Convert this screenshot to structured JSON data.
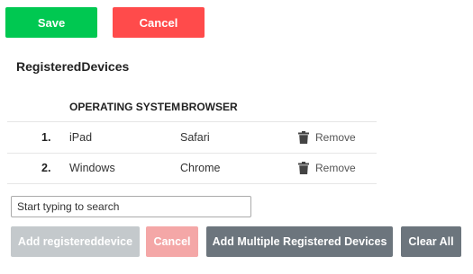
{
  "toolbar": {
    "save_label": "Save",
    "cancel_label": "Cancel"
  },
  "section": {
    "title": "RegisteredDevices"
  },
  "table": {
    "headers": [
      "OPERATING SYSTEM",
      "BROWSER"
    ],
    "rows": [
      {
        "index": "1.",
        "os": "iPad",
        "browser": "Safari",
        "action": "Remove"
      },
      {
        "index": "2.",
        "os": "Windows",
        "browser": "Chrome",
        "action": "Remove"
      }
    ]
  },
  "search": {
    "placeholder": "Start typing to search",
    "value": ""
  },
  "actions": {
    "add_label": "Add registereddevice",
    "cancel_label": "Cancel",
    "add_multiple_label": "Add Multiple Registered Devices",
    "clear_all_label": "Clear All"
  },
  "colors": {
    "save": "#00c851",
    "cancel": "#ff4b4b",
    "disabled_gray": "#c4c9cc",
    "disabled_red": "#f4a7a7",
    "secondary": "#6c757d"
  },
  "icons": {
    "remove": "trash-icon"
  }
}
